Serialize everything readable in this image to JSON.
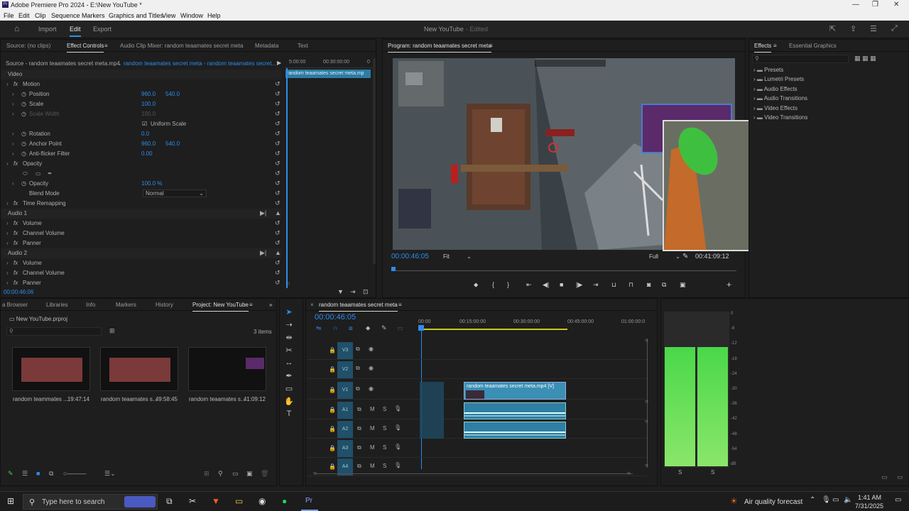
{
  "window": {
    "title": "Adobe Premiere Pro 2024 - E:\\New YouTube *",
    "logo": "Pr"
  },
  "menu": [
    "File",
    "Edit",
    "Clip",
    "Sequence",
    "Markers",
    "Graphics and Titles",
    "View",
    "Window",
    "Help"
  ],
  "workspace": {
    "tabs": [
      "Import",
      "Edit",
      "Export"
    ],
    "active": "Edit",
    "project_title": "New YouTube",
    "status": "- Edited"
  },
  "source_panel": {
    "tabs": [
      "Source: (no clips)",
      "Effect Controls",
      "Audio Clip Mixer: random teaamates secret meta",
      "Metadata",
      "Text"
    ],
    "source_line": "Source - random teaamates secret meta.mp4",
    "sequence_line": "random teaamates secret meta - random teaamates secret...",
    "mini_ruler": [
      "5:00:00",
      "00:30:00:00",
      "0"
    ],
    "mini_clip": "random teaamates secret meta.mp",
    "timecode": "00:00:46:06",
    "rows": [
      {
        "label": "Video",
        "kind": "sec"
      },
      {
        "label": "Motion",
        "kind": "fx"
      },
      {
        "label": "Position",
        "kind": "prop",
        "v1": "960.0",
        "v2": "540.0"
      },
      {
        "label": "Scale",
        "kind": "prop",
        "v1": "100.0"
      },
      {
        "label": "Scale Width",
        "kind": "dim",
        "v1": "100.0"
      },
      {
        "label": "Uniform Scale",
        "kind": "check"
      },
      {
        "label": "Rotation",
        "kind": "prop",
        "v1": "0.0"
      },
      {
        "label": "Anchor Point",
        "kind": "prop",
        "v1": "960.0",
        "v2": "540.0"
      },
      {
        "label": "Anti-flicker Filter",
        "kind": "prop",
        "v1": "0.00"
      },
      {
        "label": "Opacity",
        "kind": "fx"
      },
      {
        "label": "",
        "kind": "shapes"
      },
      {
        "label": "Opacity",
        "kind": "prop",
        "v1": "100.0 %"
      },
      {
        "label": "Blend Mode",
        "kind": "select",
        "v1": "Normal"
      },
      {
        "label": "Time Remapping",
        "kind": "fx"
      },
      {
        "label": "Audio 1",
        "kind": "sec"
      },
      {
        "label": "Volume",
        "kind": "fx"
      },
      {
        "label": "Channel Volume",
        "kind": "fx"
      },
      {
        "label": "Panner",
        "kind": "fx"
      },
      {
        "label": "Audio 2",
        "kind": "sec"
      },
      {
        "label": "Volume",
        "kind": "fx"
      },
      {
        "label": "Channel Volume",
        "kind": "fx"
      },
      {
        "label": "Panner",
        "kind": "fx"
      }
    ]
  },
  "program": {
    "title": "Program: random teaamates secret meta",
    "timecode": "00:00:46:05",
    "fit": "Fit",
    "quality": "Full",
    "duration": "00:41:09:12"
  },
  "effects": {
    "tabs": [
      "Effects",
      "Essential Graphics"
    ],
    "items": [
      "Presets",
      "Lumetri Presets",
      "Audio Effects",
      "Audio Transitions",
      "Video Effects",
      "Video Transitions"
    ]
  },
  "project": {
    "tabs": [
      "a Browser",
      "Libraries",
      "Info",
      "Markers",
      "History",
      "Project: New YouTube"
    ],
    "file": "New YouTube.prproj",
    "count": "3 items",
    "items": [
      {
        "name": "random teammates ...",
        "dur": "19:47:14"
      },
      {
        "name": "random teaamates s...",
        "dur": "49:58:45"
      },
      {
        "name": "random teaamates s...",
        "dur": "41:09:12"
      }
    ]
  },
  "timeline": {
    "title": "random teaamates secret meta",
    "timecode": "00:00:46:05",
    "ruler": [
      "00:00",
      "00:15:00:00",
      "00:30:00:00",
      "00:45:00:00",
      "01:00:00:0"
    ],
    "tracks": [
      "V3",
      "V2",
      "V1",
      "A1",
      "A2",
      "A3",
      "A4"
    ],
    "clip_label": "random teaamates secret meta.mp4 [V]"
  },
  "meter": {
    "scale": [
      "0",
      "-6",
      "-12",
      "-18",
      "-24",
      "-30",
      "-36",
      "-42",
      "-48",
      "-54",
      "dB"
    ],
    "solo": [
      "S",
      "S"
    ]
  },
  "taskbar": {
    "search": "Type here to search",
    "weather": "Air quality forecast",
    "time": "1:41 AM",
    "date": "7/31/2025"
  }
}
